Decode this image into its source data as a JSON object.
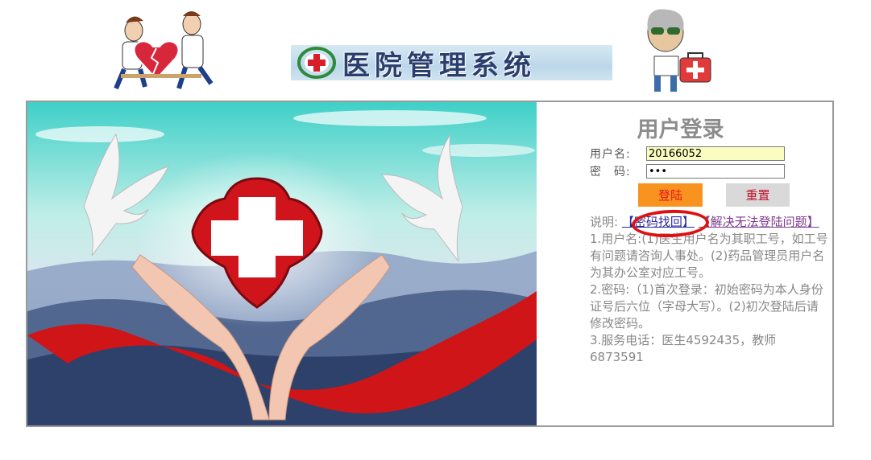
{
  "header": {
    "system_title": "医院管理系统",
    "doctors_icon": "doctors-carrying-heart-illustration",
    "emblem_icon": "red-cross-emblem",
    "mascot_icon": "mascot-with-first-aid-kit"
  },
  "photo": {
    "icons": [
      "dove-icon",
      "dove-icon",
      "red-cross-icon",
      "hands-icon",
      "red-ribbon"
    ]
  },
  "login": {
    "title": "用户登录",
    "username_label": "用户名:",
    "username_value": "20166052",
    "password_label": "密　码:",
    "password_value": "xxx",
    "login_button": "登陆",
    "reset_button": "重置",
    "notes_prefix": "说明:",
    "recover_link": "【密码找回】",
    "help_link": "【解决无法登陆问题】",
    "note_1": "1.用户名:(1)医生用户名为其职工号，如工号有问题请咨询人事处。(2)药品管理员用户名为其办公室对应工号。",
    "note_2": "2.密码:（1)首次登录：初始密码为本人身份证号后六位（字母大写）。(2)初次登陆后请修改密码。",
    "note_3": "3.服务电话：医生4592435，教师6873591"
  },
  "colors": {
    "login_button_bg": "#f7931e",
    "login_button_text": "#e8141b",
    "reset_button_bg": "#d9d9d9",
    "highlight_circle": "#e01010",
    "username_field_bg": "#fafdbf"
  }
}
